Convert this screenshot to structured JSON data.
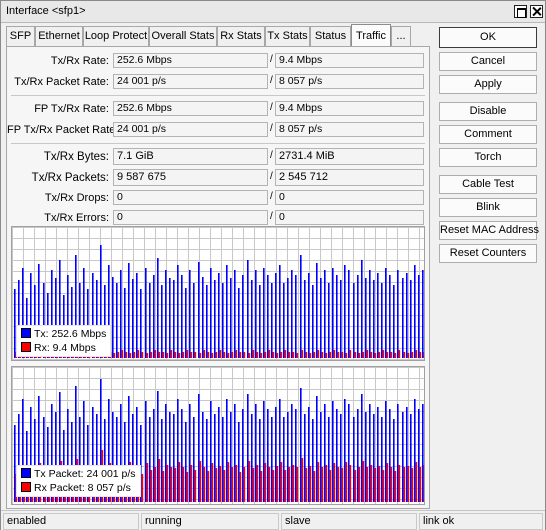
{
  "window": {
    "title": "Interface <sfp1>"
  },
  "tabs": [
    {
      "label": "SFP"
    },
    {
      "label": "Ethernet"
    },
    {
      "label": "Loop Protect"
    },
    {
      "label": "Overall Stats"
    },
    {
      "label": "Rx Stats"
    },
    {
      "label": "Tx Stats"
    },
    {
      "label": "Status"
    },
    {
      "label": "Traffic"
    },
    {
      "label": "..."
    }
  ],
  "active_tab": "Traffic",
  "fields": {
    "tx_rx_rate": {
      "label": "Tx/Rx Rate:",
      "tx": "252.6 Mbps",
      "rx": "9.4 Mbps"
    },
    "tx_rx_packet_rate": {
      "label": "Tx/Rx Packet Rate:",
      "tx": "24 001 p/s",
      "rx": "8 057 p/s"
    },
    "fp_tx_rx_rate": {
      "label": "FP Tx/Rx Rate:",
      "tx": "252.6 Mbps",
      "rx": "9.4 Mbps"
    },
    "fp_tx_rx_packet_rate": {
      "label": "FP Tx/Rx Packet Rate:",
      "tx": "24 001 p/s",
      "rx": "8 057 p/s"
    },
    "tx_rx_bytes": {
      "label": "Tx/Rx Bytes:",
      "tx": "7.1 GiB",
      "rx": "2731.4 MiB"
    },
    "tx_rx_packets": {
      "label": "Tx/Rx Packets:",
      "tx": "9 587 675",
      "rx": "2 545 712"
    },
    "tx_rx_drops": {
      "label": "Tx/Rx Drops:",
      "tx": "0",
      "rx": "0"
    },
    "tx_rx_errors": {
      "label": "Tx/Rx Errors:",
      "tx": "0",
      "rx": "0"
    },
    "separator": "/"
  },
  "graphs": {
    "traffic": {
      "legend": [
        {
          "label": "Tx:  252.6 Mbps",
          "color": "#0000ff"
        },
        {
          "label": "Rx:  9.4 Mbps",
          "color": "#ff0000"
        }
      ],
      "tx_levels": [
        0.55,
        0.62,
        0.72,
        0.48,
        0.68,
        0.58,
        0.75,
        0.6,
        0.52,
        0.7,
        0.64,
        0.78,
        0.5,
        0.66,
        0.57,
        0.82,
        0.6,
        0.72,
        0.55,
        0.68,
        0.62,
        0.9,
        0.58,
        0.74,
        0.65,
        0.6,
        0.7,
        0.56,
        0.76,
        0.63,
        0.68,
        0.55,
        0.72,
        0.6,
        0.66,
        0.8,
        0.58,
        0.7,
        0.64,
        0.62,
        0.74,
        0.66,
        0.56,
        0.7,
        0.6,
        0.77,
        0.65,
        0.58,
        0.72,
        0.62,
        0.68,
        0.6,
        0.74,
        0.64,
        0.7,
        0.56,
        0.66,
        0.78,
        0.62,
        0.7,
        0.58,
        0.72,
        0.66,
        0.6,
        0.68,
        0.74,
        0.6,
        0.64,
        0.7,
        0.66,
        0.82,
        0.62,
        0.68,
        0.58,
        0.76,
        0.64,
        0.7,
        0.6,
        0.72,
        0.66,
        0.62,
        0.74,
        0.7,
        0.6,
        0.66,
        0.78,
        0.64,
        0.7,
        0.62,
        0.68,
        0.6,
        0.72,
        0.66,
        0.58,
        0.7,
        0.64,
        0.68,
        0.62,
        0.74,
        0.66,
        0.7
      ],
      "rx_levels": [
        0.05,
        0.04,
        0.06,
        0.05,
        0.04,
        0.06,
        0.05,
        0.05,
        0.04,
        0.06,
        0.05,
        0.05,
        0.04,
        0.06,
        0.05,
        0.06,
        0.04,
        0.05,
        0.05,
        0.06,
        0.04,
        0.05,
        0.06,
        0.05,
        0.04,
        0.05,
        0.06,
        0.05,
        0.04,
        0.05,
        0.06,
        0.05,
        0.04,
        0.05,
        0.06,
        0.05,
        0.05,
        0.04,
        0.06,
        0.05,
        0.04,
        0.05,
        0.06,
        0.05,
        0.05,
        0.04,
        0.06,
        0.05,
        0.04,
        0.05,
        0.06,
        0.05,
        0.04,
        0.05,
        0.06,
        0.05,
        0.05,
        0.04,
        0.06,
        0.05,
        0.04,
        0.05,
        0.06,
        0.05,
        0.04,
        0.05,
        0.06,
        0.05,
        0.05,
        0.04,
        0.06,
        0.05,
        0.04,
        0.05,
        0.06,
        0.05,
        0.04,
        0.05,
        0.06,
        0.05,
        0.05,
        0.04,
        0.06,
        0.05,
        0.04,
        0.05,
        0.06,
        0.05,
        0.04,
        0.05,
        0.06,
        0.05,
        0.05,
        0.04,
        0.06,
        0.05,
        0.04,
        0.05,
        0.06,
        0.05,
        0.05
      ]
    },
    "packets": {
      "legend": [
        {
          "label": "Tx Packet:  24 001 p/s",
          "color": "#0000ff"
        },
        {
          "label": "Rx Packet:  8 057 p/s",
          "color": "#ff0000"
        }
      ],
      "tx_levels": [
        0.6,
        0.68,
        0.8,
        0.55,
        0.74,
        0.64,
        0.82,
        0.66,
        0.58,
        0.76,
        0.7,
        0.85,
        0.56,
        0.72,
        0.62,
        0.9,
        0.66,
        0.78,
        0.6,
        0.74,
        0.68,
        0.95,
        0.64,
        0.8,
        0.7,
        0.66,
        0.76,
        0.62,
        0.82,
        0.68,
        0.74,
        0.6,
        0.78,
        0.66,
        0.72,
        0.86,
        0.64,
        0.76,
        0.7,
        0.68,
        0.8,
        0.72,
        0.62,
        0.76,
        0.66,
        0.84,
        0.7,
        0.64,
        0.78,
        0.68,
        0.74,
        0.66,
        0.8,
        0.7,
        0.76,
        0.62,
        0.72,
        0.84,
        0.68,
        0.76,
        0.64,
        0.78,
        0.72,
        0.66,
        0.74,
        0.8,
        0.66,
        0.7,
        0.76,
        0.72,
        0.88,
        0.68,
        0.74,
        0.64,
        0.82,
        0.7,
        0.76,
        0.66,
        0.78,
        0.72,
        0.68,
        0.8,
        0.76,
        0.66,
        0.72,
        0.84,
        0.7,
        0.76,
        0.68,
        0.74,
        0.66,
        0.78,
        0.72,
        0.64,
        0.76,
        0.7,
        0.74,
        0.68,
        0.8,
        0.72,
        0.76
      ],
      "rx_levels": [
        0.22,
        0.25,
        0.28,
        0.2,
        0.26,
        0.24,
        0.3,
        0.25,
        0.22,
        0.28,
        0.26,
        0.32,
        0.21,
        0.27,
        0.23,
        0.33,
        0.25,
        0.29,
        0.22,
        0.27,
        0.26,
        0.4,
        0.24,
        0.3,
        0.27,
        0.25,
        0.29,
        0.23,
        0.31,
        0.26,
        0.28,
        0.22,
        0.3,
        0.25,
        0.27,
        0.33,
        0.24,
        0.29,
        0.27,
        0.26,
        0.31,
        0.27,
        0.23,
        0.29,
        0.25,
        0.32,
        0.27,
        0.24,
        0.3,
        0.26,
        0.28,
        0.25,
        0.31,
        0.27,
        0.29,
        0.23,
        0.27,
        0.32,
        0.26,
        0.29,
        0.24,
        0.3,
        0.27,
        0.25,
        0.28,
        0.31,
        0.25,
        0.27,
        0.29,
        0.27,
        0.34,
        0.26,
        0.28,
        0.24,
        0.31,
        0.27,
        0.29,
        0.25,
        0.3,
        0.27,
        0.26,
        0.31,
        0.29,
        0.25,
        0.27,
        0.32,
        0.27,
        0.29,
        0.26,
        0.28,
        0.25,
        0.3,
        0.27,
        0.24,
        0.29,
        0.27,
        0.28,
        0.26,
        0.31,
        0.27,
        0.29
      ]
    }
  },
  "buttons": [
    {
      "label": "OK"
    },
    {
      "label": "Cancel"
    },
    {
      "label": "Apply"
    },
    {
      "label": "Disable"
    },
    {
      "label": "Comment"
    },
    {
      "label": "Torch"
    },
    {
      "label": "Cable Test"
    },
    {
      "label": "Blink"
    },
    {
      "label": "Reset MAC Address"
    },
    {
      "label": "Reset Counters"
    }
  ],
  "status": [
    "enabled",
    "running",
    "slave",
    "link ok"
  ],
  "colors": {
    "tx": "#0000ff",
    "rx": "#ff0000",
    "grid": "#c8c8c8"
  }
}
